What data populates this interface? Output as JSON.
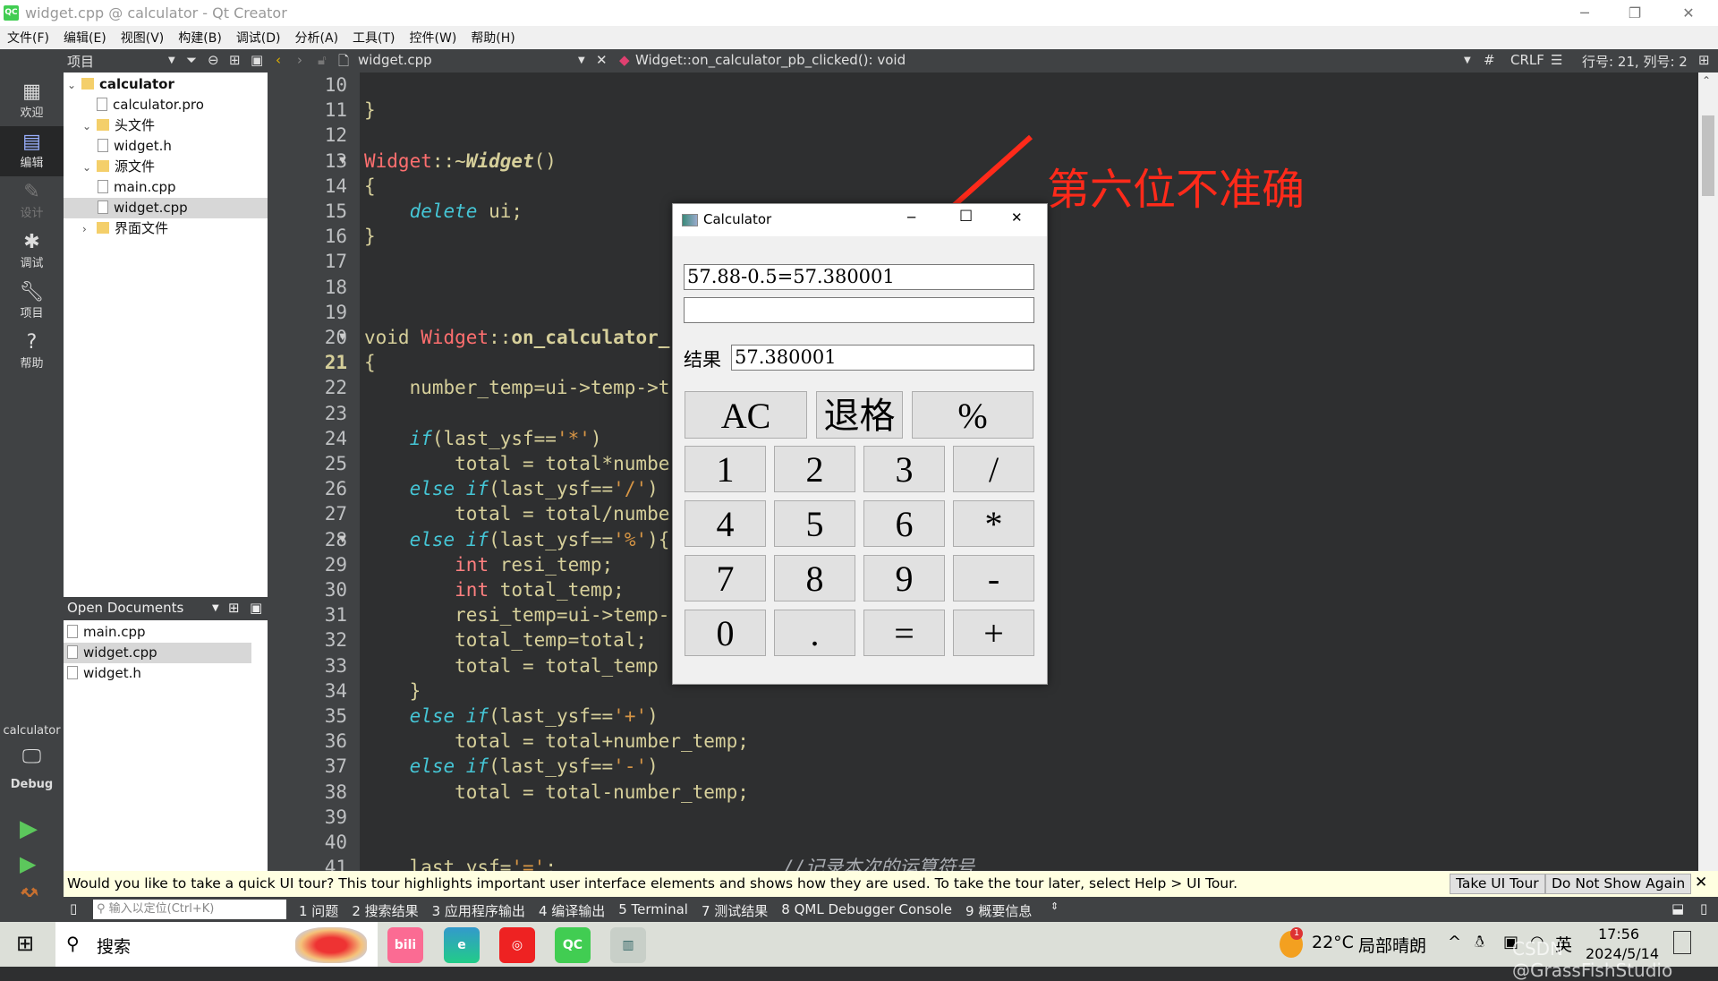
{
  "window": {
    "title": "widget.cpp @ calculator - Qt Creator",
    "app_icon": "QC"
  },
  "menu": [
    "文件(F)",
    "编辑(E)",
    "视图(V)",
    "构建(B)",
    "调试(D)",
    "分析(A)",
    "工具(T)",
    "控件(W)",
    "帮助(H)"
  ],
  "toolbar": {
    "panel": "项目",
    "file": "widget.cpp",
    "symbol": "Widget::on_calculator_pb_clicked(): void",
    "hash": "#",
    "eol": "CRLF",
    "position": "行号: 21, 列号: 2"
  },
  "modes": [
    {
      "label": "欢迎",
      "icon": "grid-icon"
    },
    {
      "label": "编辑",
      "icon": "edit-icon",
      "selected": true
    },
    {
      "label": "设计",
      "icon": "pencil-icon",
      "disabled": true
    },
    {
      "label": "调试",
      "icon": "bug-icon"
    },
    {
      "label": "项目",
      "icon": "wrench-icon"
    },
    {
      "label": "帮助",
      "icon": "help-icon"
    }
  ],
  "kit": {
    "project": "calculator",
    "config": "Debug"
  },
  "tree": [
    {
      "label": "calculator",
      "level": 0,
      "type": "project",
      "expanded": true
    },
    {
      "label": "calculator.pro",
      "level": 1,
      "type": "file"
    },
    {
      "label": "头文件",
      "level": 1,
      "type": "folder",
      "expanded": true
    },
    {
      "label": "widget.h",
      "level": 2,
      "type": "file"
    },
    {
      "label": "源文件",
      "level": 1,
      "type": "folder",
      "expanded": true
    },
    {
      "label": "main.cpp",
      "level": 2,
      "type": "file"
    },
    {
      "label": "widget.cpp",
      "level": 2,
      "type": "file",
      "selected": true
    },
    {
      "label": "界面文件",
      "level": 1,
      "type": "folder",
      "expanded": false
    }
  ],
  "open_documents": {
    "title": "Open Documents",
    "items": [
      {
        "label": "main.cpp"
      },
      {
        "label": "widget.cpp",
        "selected": true
      },
      {
        "label": "widget.h"
      }
    ]
  },
  "editor": {
    "current_line": 21,
    "first_line": 10,
    "lines": [
      [],
      [
        [
          "}",
          ""
        ]
      ],
      [],
      [
        [
          "Widget",
          "s-red"
        ],
        [
          "::~",
          ""
        ],
        [
          "Widget",
          "s-fn"
        ],
        [
          "()",
          ""
        ]
      ],
      [
        [
          "{",
          ""
        ]
      ],
      [
        [
          "    ",
          ""
        ],
        [
          "delete",
          "s-kw"
        ],
        [
          " ui;",
          ""
        ]
      ],
      [
        [
          "}",
          ""
        ]
      ],
      [],
      [],
      [],
      [
        [
          "void ",
          ""
        ],
        [
          "Widget",
          "s-red"
        ],
        [
          "::",
          ""
        ],
        [
          "on_calculator_",
          "s-b"
        ]
      ],
      [
        [
          "{",
          ""
        ]
      ],
      [
        [
          "    number_temp=ui->temp->t",
          ""
        ]
      ],
      [],
      [
        [
          "    ",
          ""
        ],
        [
          "if",
          "s-kw"
        ],
        [
          "(last_ysf==",
          ""
        ],
        [
          "'*'",
          "s-str"
        ],
        [
          ")",
          ""
        ]
      ],
      [
        [
          "        total = total*numbe",
          ""
        ]
      ],
      [
        [
          "    ",
          ""
        ],
        [
          "else if",
          "s-kw"
        ],
        [
          "(last_ysf==",
          ""
        ],
        [
          "'/'",
          "s-str"
        ],
        [
          ")",
          ""
        ]
      ],
      [
        [
          "        total = total/numbe",
          ""
        ]
      ],
      [
        [
          "    ",
          ""
        ],
        [
          "else if",
          "s-kw"
        ],
        [
          "(last_ysf==",
          ""
        ],
        [
          "'%'",
          "s-str"
        ],
        [
          "){",
          ""
        ]
      ],
      [
        [
          "        ",
          ""
        ],
        [
          "int",
          "s-ty"
        ],
        [
          " resi_temp;",
          ""
        ]
      ],
      [
        [
          "        ",
          ""
        ],
        [
          "int",
          "s-ty"
        ],
        [
          " total_temp;",
          ""
        ]
      ],
      [
        [
          "        resi_temp=ui->temp-",
          ""
        ]
      ],
      [
        [
          "        total_temp=total;",
          ""
        ]
      ],
      [
        [
          "        total = total_temp",
          ""
        ]
      ],
      [
        [
          "    }",
          ""
        ]
      ],
      [
        [
          "    ",
          ""
        ],
        [
          "else if",
          "s-kw"
        ],
        [
          "(last_ysf==",
          ""
        ],
        [
          "'+'",
          "s-str"
        ],
        [
          ")",
          ""
        ]
      ],
      [
        [
          "        total = total+number_temp;",
          ""
        ]
      ],
      [
        [
          "    ",
          ""
        ],
        [
          "else if",
          "s-kw"
        ],
        [
          "(last_ysf==",
          ""
        ],
        [
          "'-'",
          "s-str"
        ],
        [
          ")",
          ""
        ]
      ],
      [
        [
          "        total = total-number_temp;",
          ""
        ]
      ],
      [],
      [],
      [
        [
          "    last_ysf=",
          ""
        ],
        [
          "'='",
          "s-str"
        ],
        [
          ";                    ",
          ""
        ],
        [
          "//记录本次的运算符号",
          "s-cm"
        ]
      ]
    ],
    "fold_lines": [
      13,
      20,
      28
    ]
  },
  "calculator": {
    "title": "Calculator",
    "expression": "57.88-0.5=57.380001",
    "input2": "",
    "result_label": "结果",
    "result": "57.380001",
    "buttons": [
      [
        "AC",
        "退格",
        "%"
      ],
      [
        "1",
        "2",
        "3",
        "/"
      ],
      [
        "4",
        "5",
        "6",
        "*"
      ],
      [
        "7",
        "8",
        "9",
        "-"
      ],
      [
        "0",
        ".",
        "=",
        "+"
      ]
    ]
  },
  "annotation": {
    "text": "第六位不准确",
    "color": "#ff2a1a"
  },
  "tour": {
    "message": "Would you like to take a quick UI tour? This tour highlights important user interface elements and shows how they are used. To take the tour later, select Help > UI Tour.",
    "take": "Take UI Tour",
    "dismiss": "Do Not Show Again"
  },
  "output_bar": {
    "locator_placeholder": "输入以定位(Ctrl+K)",
    "tabs": [
      "1 问题",
      "2 搜索结果",
      "3 应用程序输出",
      "4 编译输出",
      "5 Terminal",
      "7 测试结果",
      "8 QML Debugger Console",
      "9 概要信息"
    ]
  },
  "taskbar": {
    "search": "搜索",
    "apps": [
      "bilibili",
      "edge",
      "netease-music",
      "qt-creator",
      "calculator"
    ],
    "weather": "22°C",
    "weather_desc": "局部晴朗",
    "badge": "1",
    "ime": "英",
    "time": "17:56",
    "date": "2024/5/14",
    "watermark": "CSDN @GrassFishStudio"
  }
}
